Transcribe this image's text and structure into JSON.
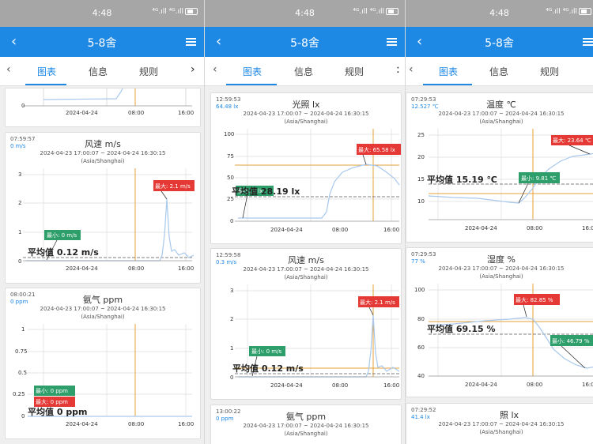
{
  "status": {
    "time": "4:48",
    "signal": "⁴ᴳ.ıll ⁴ᴳ.ıll"
  },
  "appbar": {
    "title": "5-8舍"
  },
  "tabs": {
    "charts": "图表",
    "info": "信息",
    "rules": "规则"
  },
  "labels": {
    "max": "最大",
    "min": "最小",
    "avg": "平均值"
  },
  "shared": {
    "range": "2024-04-23 17:00:07 ~ 2024-04-24 16:30:15",
    "timezone": "(Asia/Shanghai)",
    "x_ticks": [
      "2024-04-24",
      "08:00",
      "16:00"
    ]
  },
  "screens": [
    {
      "cards": [
        {
          "title": "",
          "timestamp": "",
          "value": "",
          "y_ticks": [
            "0"
          ],
          "avg_text": "",
          "max_text": "",
          "min_text": ""
        },
        {
          "title": "风速 m/s",
          "timestamp": "07:59:57",
          "value": "0 m/s",
          "y_ticks": [
            "0",
            "1",
            "2",
            "3"
          ],
          "avg_text": "平均值 0.12 m/s",
          "max_text": "最大: 2.1 m/s",
          "min_text": "最小: 0 m/s"
        },
        {
          "title": "氨气 ppm",
          "timestamp": "08:00:21",
          "value": "0 ppm",
          "y_ticks": [
            "0",
            "0.25",
            "0.5",
            "0.75",
            "1"
          ],
          "avg_text": "平均值 0 ppm",
          "max_text": "最大: 0 ppm",
          "min_text": "最小: 0 ppm"
        }
      ]
    },
    {
      "cards": [
        {
          "title": "光照 lx",
          "timestamp": "12:59:53",
          "value": "64.48 lx",
          "y_ticks": [
            "0",
            "25",
            "50",
            "75",
            "100"
          ],
          "avg_text": "平均值 28.19 lx",
          "max_text": "最大: 65.58 lx",
          "min_text": "最小: 0 lx"
        },
        {
          "title": "风速 m/s",
          "timestamp": "12:59:58",
          "value": "0.3 m/s",
          "y_ticks": [
            "0",
            "1",
            "2",
            "3"
          ],
          "avg_text": "平均值 0.12 m/s",
          "max_text": "最大: 2.1 m/s",
          "min_text": "最小: 0 m/s"
        },
        {
          "title": "氨气 ppm",
          "timestamp": "13:00:22",
          "value": "0 ppm",
          "y_ticks": [],
          "avg_text": "",
          "max_text": "",
          "min_text": ""
        }
      ]
    },
    {
      "cards": [
        {
          "title": "温度 ℃",
          "timestamp": "07:29:53",
          "value": "12.527 ℃",
          "y_ticks": [
            "10",
            "15",
            "20",
            "25"
          ],
          "avg_text": "平均值 15.19 ℃",
          "max_text": "最大: 23.64 ℃",
          "min_text": "最小: 9.81 ℃"
        },
        {
          "title": "湿度 %",
          "timestamp": "07:29:53",
          "value": "77 %",
          "y_ticks": [
            "40",
            "60",
            "80",
            "100"
          ],
          "avg_text": "平均值 69.15 %",
          "max_text": "最大: 82.85 %",
          "min_text": "最小: 46.79 %"
        },
        {
          "title": "照 lx",
          "timestamp": "07:29:52",
          "value": "41.4 lx",
          "y_ticks": [],
          "avg_text": "",
          "max_text": "",
          "min_text": ""
        }
      ]
    }
  ],
  "colors": {
    "primary": "#1e88e5",
    "status_bar": "#a6a6a6",
    "line": "#a8c8ec",
    "max_badge": "#e53935",
    "min_badge": "#2e9e6a",
    "cursor": "#e5a03a",
    "avg_line": "#555555"
  }
}
